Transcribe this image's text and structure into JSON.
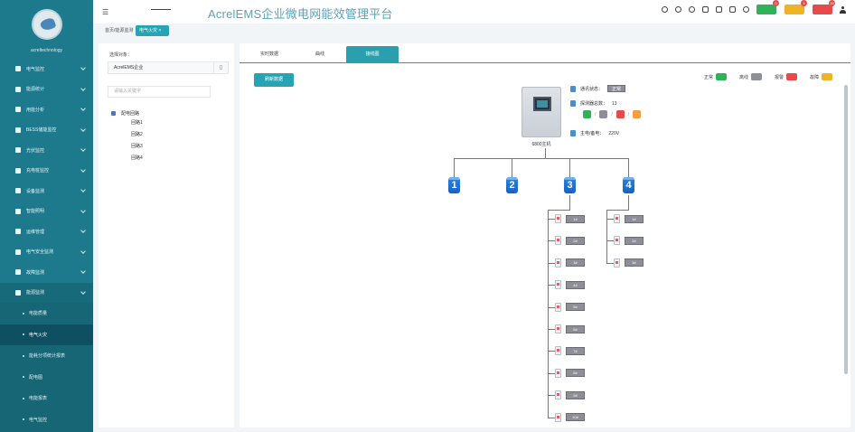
{
  "app": {
    "title": "AcrelEMS企业微电网能效管理平台",
    "username": "acreltechnology"
  },
  "topbar": {
    "badges": [
      {
        "name": "notify",
        "color": "#2fb35a",
        "count": "0"
      },
      {
        "name": "warning",
        "color": "#f0b323",
        "count": "4"
      },
      {
        "name": "alarm",
        "color": "#e84a4a",
        "count": "16"
      }
    ]
  },
  "sidebar": {
    "items": [
      {
        "label": "电气监控",
        "icon": "monitor-icon"
      },
      {
        "label": "能源统计",
        "icon": "chart-icon"
      },
      {
        "label": "用能分析",
        "icon": "analysis-icon"
      },
      {
        "label": "BESS储能监控",
        "icon": "battery-icon"
      },
      {
        "label": "光伏监控",
        "icon": "solar-icon"
      },
      {
        "label": "充电桩监控",
        "icon": "charger-icon"
      },
      {
        "label": "设备监测",
        "icon": "device-icon"
      },
      {
        "label": "智能照明",
        "icon": "light-icon"
      },
      {
        "label": "运维管理",
        "icon": "tools-icon"
      },
      {
        "label": "电气安全监测",
        "icon": "shield-icon"
      },
      {
        "label": "故障监测",
        "icon": "fault-icon"
      },
      {
        "label": "能源监测",
        "icon": "energy-icon",
        "open": true
      }
    ],
    "subitems": [
      {
        "label": "电能质量"
      },
      {
        "label": "电气火灾",
        "active": true
      },
      {
        "label": "能耗分项统计报表"
      },
      {
        "label": "配电图"
      },
      {
        "label": "电能报表"
      },
      {
        "label": "电气监控"
      },
      {
        "label": "能耗分析"
      }
    ]
  },
  "breadcrumb": {
    "items": [
      "首页/能源监测",
      "电气火灾 ×"
    ]
  },
  "leftpanel": {
    "label": "选择对象：",
    "select_value": "AcrelEMS企业",
    "search_placeholder": "请输入关键字",
    "tree_root": "配电回路",
    "tree_children": [
      "回路1",
      "回路2",
      "回路3",
      "回路4"
    ]
  },
  "main": {
    "tabs": [
      "实时数据",
      "曲线",
      "接线图"
    ],
    "active_tab": 2,
    "action_button": "刷新数据",
    "legend": [
      {
        "label": "正常",
        "color": "#2fb35a"
      },
      {
        "label": "离线",
        "color": "#8e8e99"
      },
      {
        "label": "报警",
        "color": "#e84a4a"
      },
      {
        "label": "故障",
        "color": "#f0b323"
      }
    ],
    "device": {
      "name": "6800主机",
      "info": [
        {
          "label": "通讯状态：",
          "value": "正常"
        },
        {
          "label": "探测器总数：",
          "value": "13"
        },
        {
          "label": "主电/备电：",
          "value": "220V"
        }
      ],
      "status_colors": [
        "#2fb35a",
        "#8e8e99",
        "#e84a4a",
        "#f0a040"
      ]
    },
    "channels": [
      {
        "number": "1"
      },
      {
        "number": "2"
      },
      {
        "number": "3"
      },
      {
        "number": "4"
      }
    ],
    "branch3_leaves": [
      "1#",
      "2#",
      "3#",
      "4#",
      "5#",
      "6#",
      "7#",
      "8#",
      "9#",
      "10#"
    ],
    "branch4_leaves": [
      "1#",
      "2#",
      "3#"
    ]
  }
}
